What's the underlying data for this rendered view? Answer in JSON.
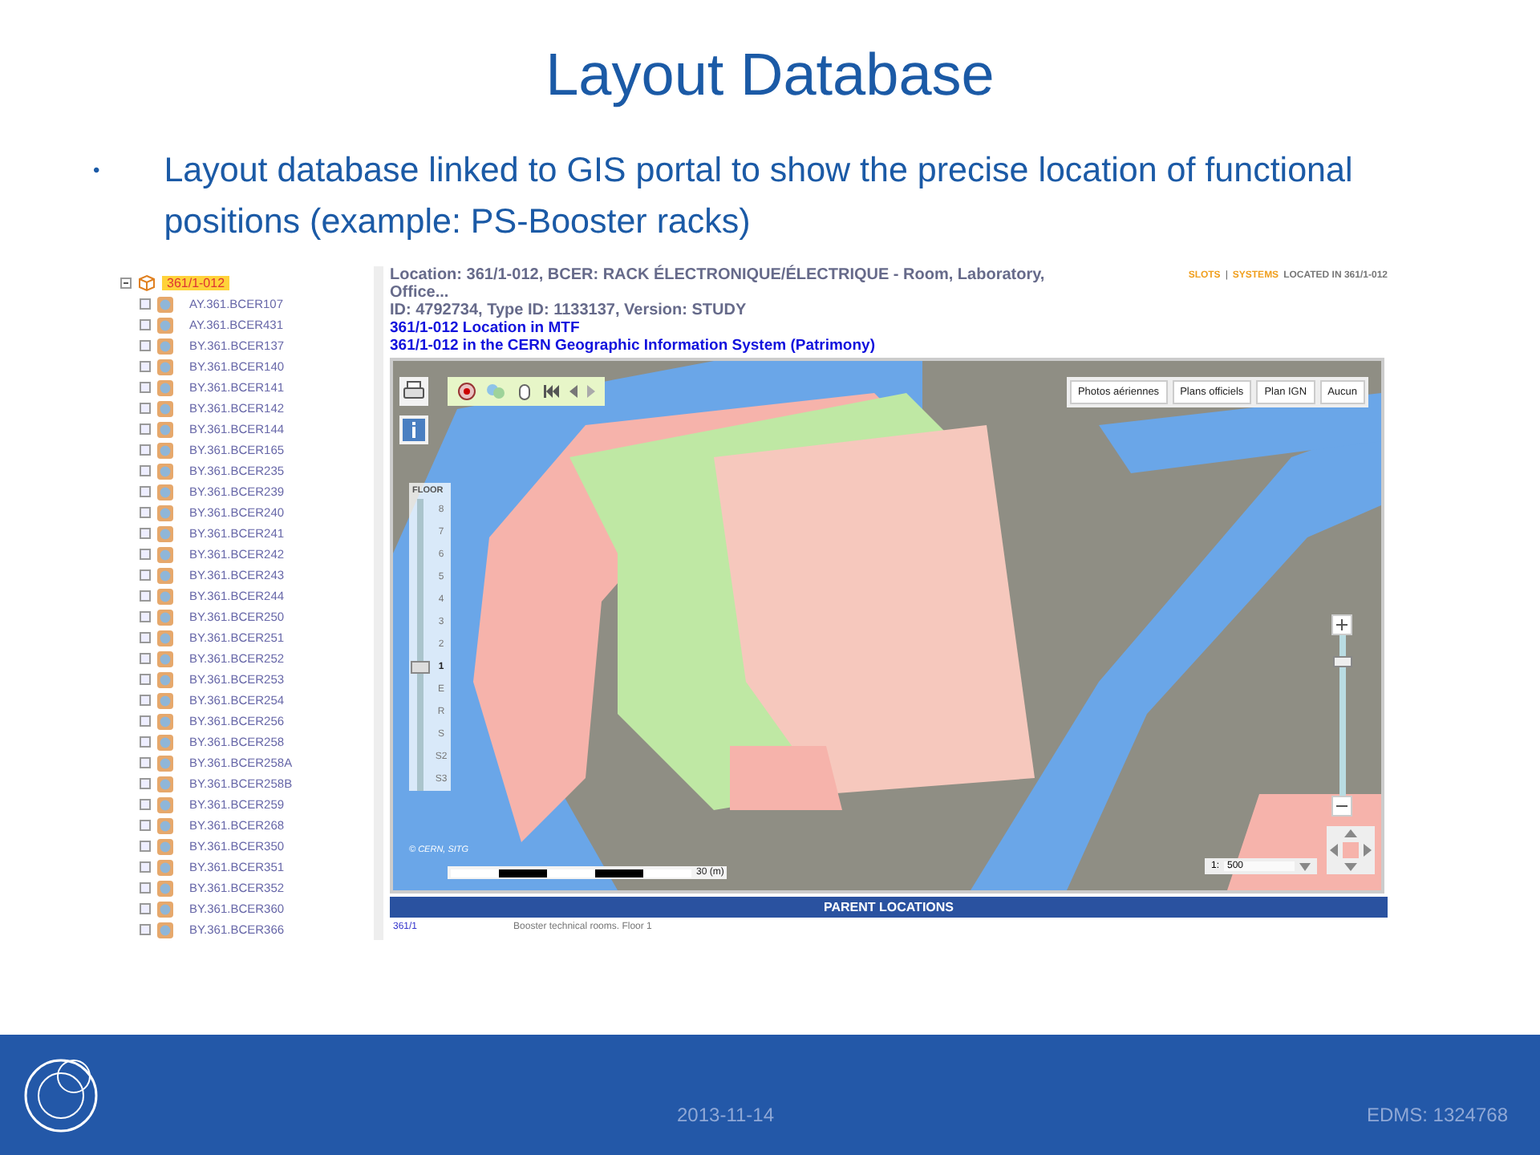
{
  "slide": {
    "title": "Layout Database",
    "bullets": [
      {
        "marker": "•",
        "text": "Layout database linked to GIS portal to show the precise location of functional positions (example: PS-Booster racks)"
      }
    ]
  },
  "tree": {
    "root": {
      "label": "361/1-012",
      "selected": true,
      "expanded": true
    },
    "children": [
      {
        "label": "AY.361.BCER107"
      },
      {
        "label": "AY.361.BCER431"
      },
      {
        "label": "BY.361.BCER137"
      },
      {
        "label": "BY.361.BCER140"
      },
      {
        "label": "BY.361.BCER141"
      },
      {
        "label": "BY.361.BCER142"
      },
      {
        "label": "BY.361.BCER144"
      },
      {
        "label": "BY.361.BCER165"
      },
      {
        "label": "BY.361.BCER235"
      },
      {
        "label": "BY.361.BCER239"
      },
      {
        "label": "BY.361.BCER240"
      },
      {
        "label": "BY.361.BCER241"
      },
      {
        "label": "BY.361.BCER242"
      },
      {
        "label": "BY.361.BCER243"
      },
      {
        "label": "BY.361.BCER244"
      },
      {
        "label": "BY.361.BCER250"
      },
      {
        "label": "BY.361.BCER251"
      },
      {
        "label": "BY.361.BCER252"
      },
      {
        "label": "BY.361.BCER253"
      },
      {
        "label": "BY.361.BCER254"
      },
      {
        "label": "BY.361.BCER256"
      },
      {
        "label": "BY.361.BCER258"
      },
      {
        "label": "BY.361.BCER258A"
      },
      {
        "label": "BY.361.BCER258B"
      },
      {
        "label": "BY.361.BCER259"
      },
      {
        "label": "BY.361.BCER268"
      },
      {
        "label": "BY.361.BCER350"
      },
      {
        "label": "BY.361.BCER351"
      },
      {
        "label": "BY.361.BCER352"
      },
      {
        "label": "BY.361.BCER360"
      },
      {
        "label": "BY.361.BCER366"
      }
    ]
  },
  "detail": {
    "location": "Location: 361/1-012, BCER: RACK ÉLECTRONIQUE/ÉLECTRIQUE - Room, Laboratory, Office...",
    "ids": "ID: 4792734, Type ID: 1133137, Version: STUDY",
    "links": [
      "361/1-012 Location in MTF",
      "361/1-012 in the CERN Geographic Information System (Patrimony)"
    ],
    "top_links": [
      {
        "label": "SLOTS",
        "kind": "link"
      },
      {
        "label": "|",
        "kind": "sep"
      },
      {
        "label": "SYSTEMS",
        "kind": "link"
      },
      {
        "label": "LOCATED IN 361/1-012",
        "kind": "text"
      }
    ]
  },
  "map": {
    "layers": [
      "Photos aériennes",
      "Plans officiels",
      "Plan IGN",
      "Aucun"
    ],
    "floor_title": "FLOOR",
    "floors": [
      {
        "label": "8",
        "selected": false
      },
      {
        "label": "7",
        "selected": false
      },
      {
        "label": "6",
        "selected": false
      },
      {
        "label": "5",
        "selected": false
      },
      {
        "label": "4",
        "selected": false
      },
      {
        "label": "3",
        "selected": false
      },
      {
        "label": "2",
        "selected": false
      },
      {
        "label": "1",
        "selected": true
      },
      {
        "label": "E",
        "selected": false
      },
      {
        "label": "R",
        "selected": false
      },
      {
        "label": "S",
        "selected": false
      },
      {
        "label": "S2",
        "selected": false
      },
      {
        "label": "S3",
        "selected": false
      }
    ],
    "zoom": {
      "level": 0.85
    },
    "attribution": "© CERN, SITG",
    "scale": "30 (m)",
    "scale_prefix": "1:",
    "scale_value": "500"
  },
  "parent_locations": {
    "title": "PARENT LOCATIONS",
    "rows": [
      {
        "code": "361/1",
        "description": "Booster technical rooms. Floor 1"
      }
    ]
  },
  "footer": {
    "date": "2013-11-14",
    "ref": "EDMS: 1324768"
  }
}
